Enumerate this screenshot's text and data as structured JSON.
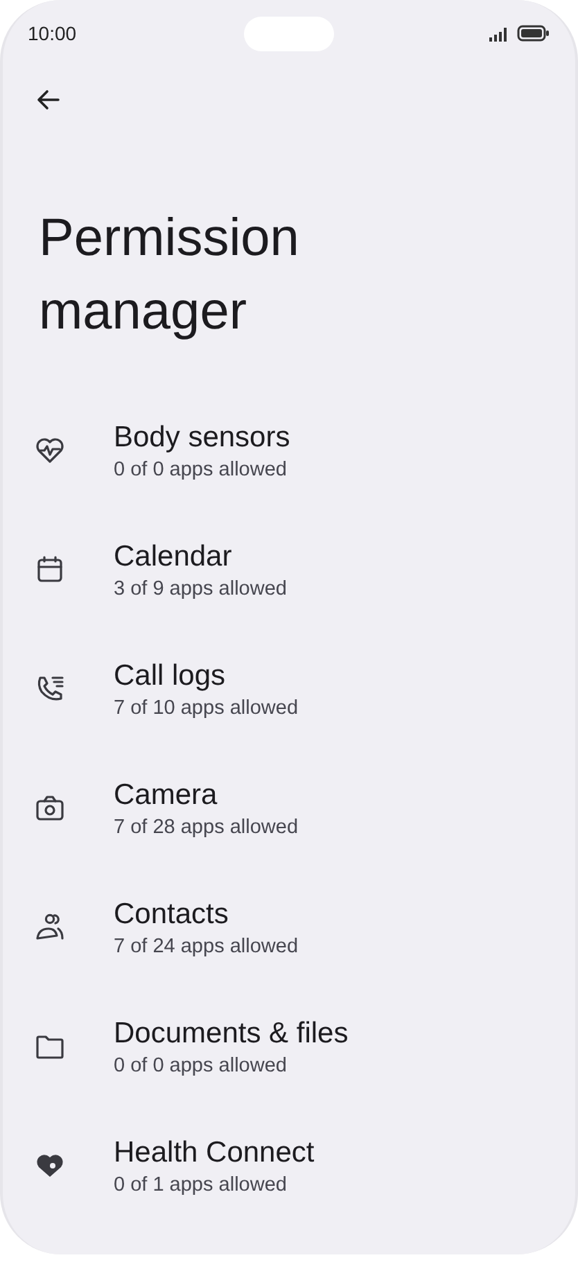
{
  "status_bar": {
    "time": "10:00"
  },
  "title": "Permission manager",
  "permissions": [
    {
      "kind": "body-sensors",
      "label": "Body sensors",
      "summary": "0 of 0 apps allowed"
    },
    {
      "kind": "calendar",
      "label": "Calendar",
      "summary": "3 of 9 apps allowed"
    },
    {
      "kind": "call-logs",
      "label": "Call logs",
      "summary": "7 of 10 apps allowed"
    },
    {
      "kind": "camera",
      "label": "Camera",
      "summary": "7 of 28 apps allowed"
    },
    {
      "kind": "contacts",
      "label": "Contacts",
      "summary": "7 of 24 apps allowed"
    },
    {
      "kind": "files",
      "label": "Documents & files",
      "summary": "0 of 0 apps allowed"
    },
    {
      "kind": "health",
      "label": "Health Connect",
      "summary": "0 of 1 apps allowed"
    }
  ]
}
